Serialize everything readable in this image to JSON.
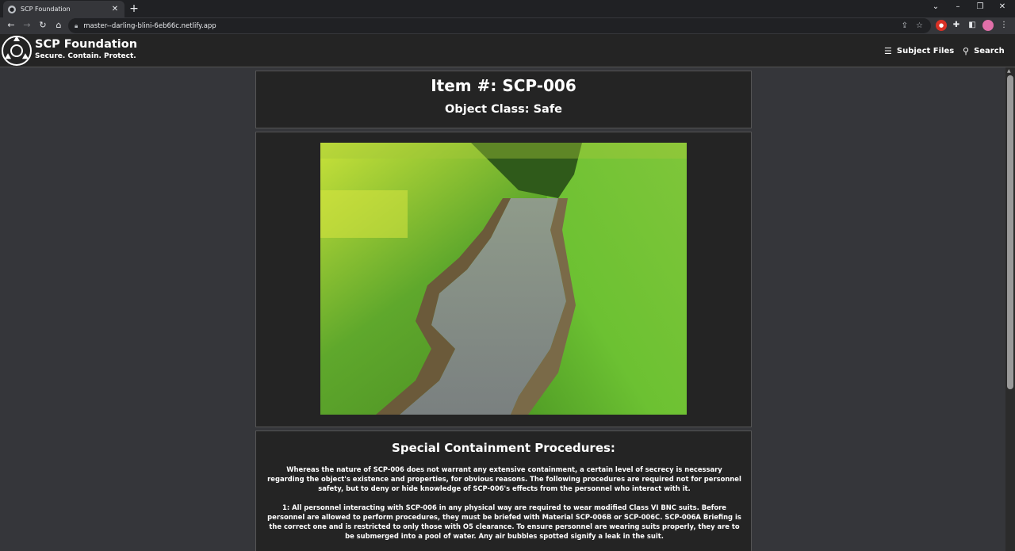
{
  "browser": {
    "tab_title": "SCP Foundation",
    "tab_close": "✕",
    "new_tab": "+",
    "url": "master--darling-blini-6eb66c.netlify.app",
    "icons": [
      "back-icon",
      "forward-icon",
      "reload-icon",
      "home-icon",
      "lock-icon",
      "share-icon",
      "star-icon",
      "extension-icon",
      "puzzle-icon",
      "sidebar-icon",
      "profile-avatar",
      "menu-icon"
    ]
  },
  "site": {
    "title": "SCP Foundation",
    "tagline": "Secure. Contain. Protect.",
    "nav": {
      "subject_files": "Subject Files",
      "search": "Search"
    }
  },
  "item": {
    "number": "Item #: SCP-006",
    "object_class": "Object Class: Safe"
  },
  "procedures": {
    "heading": "Special Containment Procedures:",
    "paragraphs": [
      "Whereas the nature of SCP-006 does not warrant any extensive containment, a certain level of secrecy is necessary regarding the object's existence and properties, for obvious reasons. The following procedures are required not for personnel safety, but to deny or hide knowledge of SCP-006's effects from the personnel who interact with it.",
      "1: All personnel interacting with SCP-006 in any physical way are required to wear modified Class VI BNC suits. Before personnel are allowed to perform procedures, they must be briefed with Material SCP-006B or SCP-006C. SCP-006A Briefing is the correct one and is restricted to only those with O5 clearance. To ensure personnel are wearing suits properly, they are to be submerged into a pool of water. Any air bubbles spotted signify a leak in the suit."
    ]
  }
}
